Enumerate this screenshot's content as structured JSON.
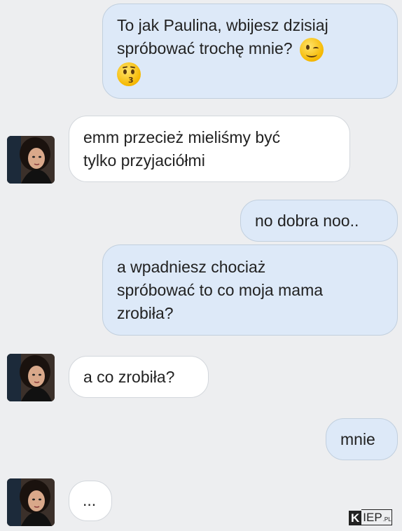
{
  "messages": [
    {
      "side": "sent",
      "lines": [
        "To jak Paulina, wbijesz dzisiaj",
        "spróbować trochę mnie?",
        ""
      ],
      "emoji": [
        "winking-face",
        "kissing-face"
      ]
    },
    {
      "side": "received",
      "lines": [
        "emm przecież mieliśmy być",
        "tylko przyjaciółmi"
      ]
    },
    {
      "side": "sent",
      "lines": [
        "no dobra noo.."
      ]
    },
    {
      "side": "sent",
      "lines": [
        "a wpadniesz chociaż",
        "spróbować to co moja mama",
        "zrobiła?"
      ]
    },
    {
      "side": "received",
      "lines": [
        "a co zrobiła?"
      ]
    },
    {
      "side": "sent",
      "lines": [
        "mnie"
      ]
    },
    {
      "side": "received",
      "lines": [
        "..."
      ]
    }
  ],
  "watermark": {
    "k": "K",
    "rest": "IEP",
    "tld": ".PL"
  },
  "colors": {
    "background": "#edeef0",
    "sent_bubble": "#dde9f8",
    "received_bubble": "#ffffff"
  }
}
